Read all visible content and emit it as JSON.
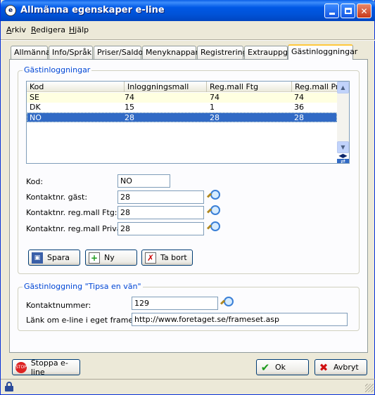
{
  "window": {
    "title": "Allmänna egenskaper e-line"
  },
  "menu": [
    {
      "label": "Arkiv"
    },
    {
      "label": "Redigera"
    },
    {
      "label": "Hjälp"
    }
  ],
  "tabs": [
    {
      "label": "Allmänna"
    },
    {
      "label": "Info/Språk"
    },
    {
      "label": "Priser/Saldo"
    },
    {
      "label": "Menyknappar"
    },
    {
      "label": "Registrering"
    },
    {
      "label": "Extrauppg."
    },
    {
      "label": "Gästinloggningar",
      "active": true
    }
  ],
  "guest_group": {
    "title": "Gästinloggningar",
    "columns": [
      "Kod",
      "Inloggningsmall",
      "Reg.mall Ftg",
      "Reg.mall Privat"
    ],
    "rows": [
      {
        "cells": [
          "SE",
          "74",
          "74",
          "74"
        ],
        "state": "alt"
      },
      {
        "cells": [
          "DK",
          "15",
          "1",
          "36"
        ],
        "state": "normal"
      },
      {
        "cells": [
          "NO",
          "28",
          "28",
          "28"
        ],
        "state": "selected"
      }
    ]
  },
  "form": {
    "kod_label": "Kod:",
    "kod_value": "NO",
    "guest_label": "Kontaktnr. gäst:",
    "guest_value": "28",
    "ftg_label": "Kontaktnr. reg.mall Ftg:",
    "ftg_value": "28",
    "privat_label": "Kontaktnr. reg.mall Privat:",
    "privat_value": "28"
  },
  "buttons": {
    "save": "Spara",
    "new": "Ny",
    "delete": "Ta bort",
    "stop": "Stoppa e-line",
    "ok": "Ok",
    "cancel": "Avbryt"
  },
  "tips_group": {
    "title": "Gästinloggning \"Tipsa en vän\"",
    "contact_label": "Kontaktnummer:",
    "contact_value": "129",
    "frameset_label": "Länk om e-line i eget frameset:",
    "frameset_value": "http://www.foretaget.se/frameset.asp"
  },
  "icons": {
    "app": "e-line-logo-icon",
    "search": "magnifier-icon",
    "save": "floppy-disk-icon",
    "new": "new-document-icon",
    "delete": "delete-document-icon",
    "stop": "stop-sign-icon",
    "ok": "checkmark-icon",
    "cancel": "red-x-icon",
    "status": "lock-icon"
  },
  "colors": {
    "titlebar": "#0058e6",
    "selection": "#316ac5",
    "alt_row": "#ffffe1",
    "group_title": "#0046d5"
  }
}
